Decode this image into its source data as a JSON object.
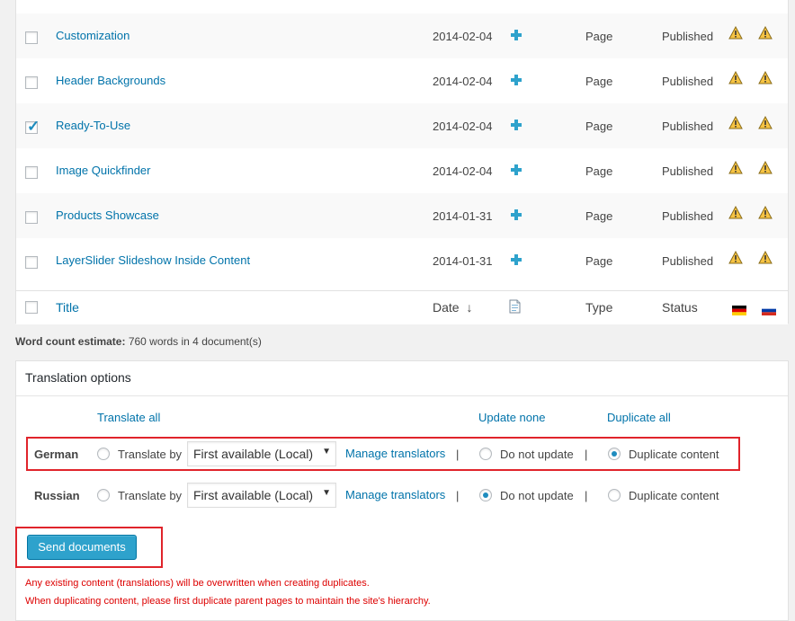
{
  "posts": [
    {
      "title": "Customization",
      "date": "2014-02-04",
      "type": "Page",
      "status": "Published",
      "checked": false
    },
    {
      "title": "Header Backgrounds",
      "date": "2014-02-04",
      "type": "Page",
      "status": "Published",
      "checked": false
    },
    {
      "title": "Ready-To-Use",
      "date": "2014-02-04",
      "type": "Page",
      "status": "Published",
      "checked": true
    },
    {
      "title": "Image Quickfinder",
      "date": "2014-02-04",
      "type": "Page",
      "status": "Published",
      "checked": false
    },
    {
      "title": "Products Showcase",
      "date": "2014-01-31",
      "type": "Page",
      "status": "Published",
      "checked": false
    },
    {
      "title": "LayerSlider Slideshow Inside Content",
      "date": "2014-01-31",
      "type": "Page",
      "status": "Published",
      "checked": false
    }
  ],
  "table_header": {
    "title": "Title",
    "date": "Date",
    "sort_arrow": "↓",
    "type": "Type",
    "status": "Status"
  },
  "word_count": {
    "label": "Word count estimate:",
    "value": "760 words in 4 document(s)"
  },
  "translation_options": {
    "title": "Translation options",
    "translate_all": "Translate all",
    "update_none": "Update none",
    "duplicate_all": "Duplicate all",
    "languages": [
      {
        "name": "German",
        "translate_label": "Translate by",
        "select_value": "First available (Local)",
        "manage_label": "Manage translators",
        "sep": "|",
        "do_not_update": "Do not update",
        "duplicate_content": "Duplicate content",
        "selected": "duplicate"
      },
      {
        "name": "Russian",
        "translate_label": "Translate by",
        "select_value": "First available (Local)",
        "manage_label": "Manage translators",
        "sep": "|",
        "do_not_update": "Do not update",
        "duplicate_content": "Duplicate content",
        "selected": "none"
      }
    ]
  },
  "send_button": "Send documents",
  "notes": [
    "Any existing content (translations) will be overwritten when creating duplicates.",
    "When duplicating content, please first duplicate parent pages to maintain the site's hierarchy."
  ],
  "colors": {
    "link": "#0073aa",
    "accent": "#2ea2cc",
    "warning_note": "#dd0000",
    "highlight_box": "#e0242b"
  }
}
